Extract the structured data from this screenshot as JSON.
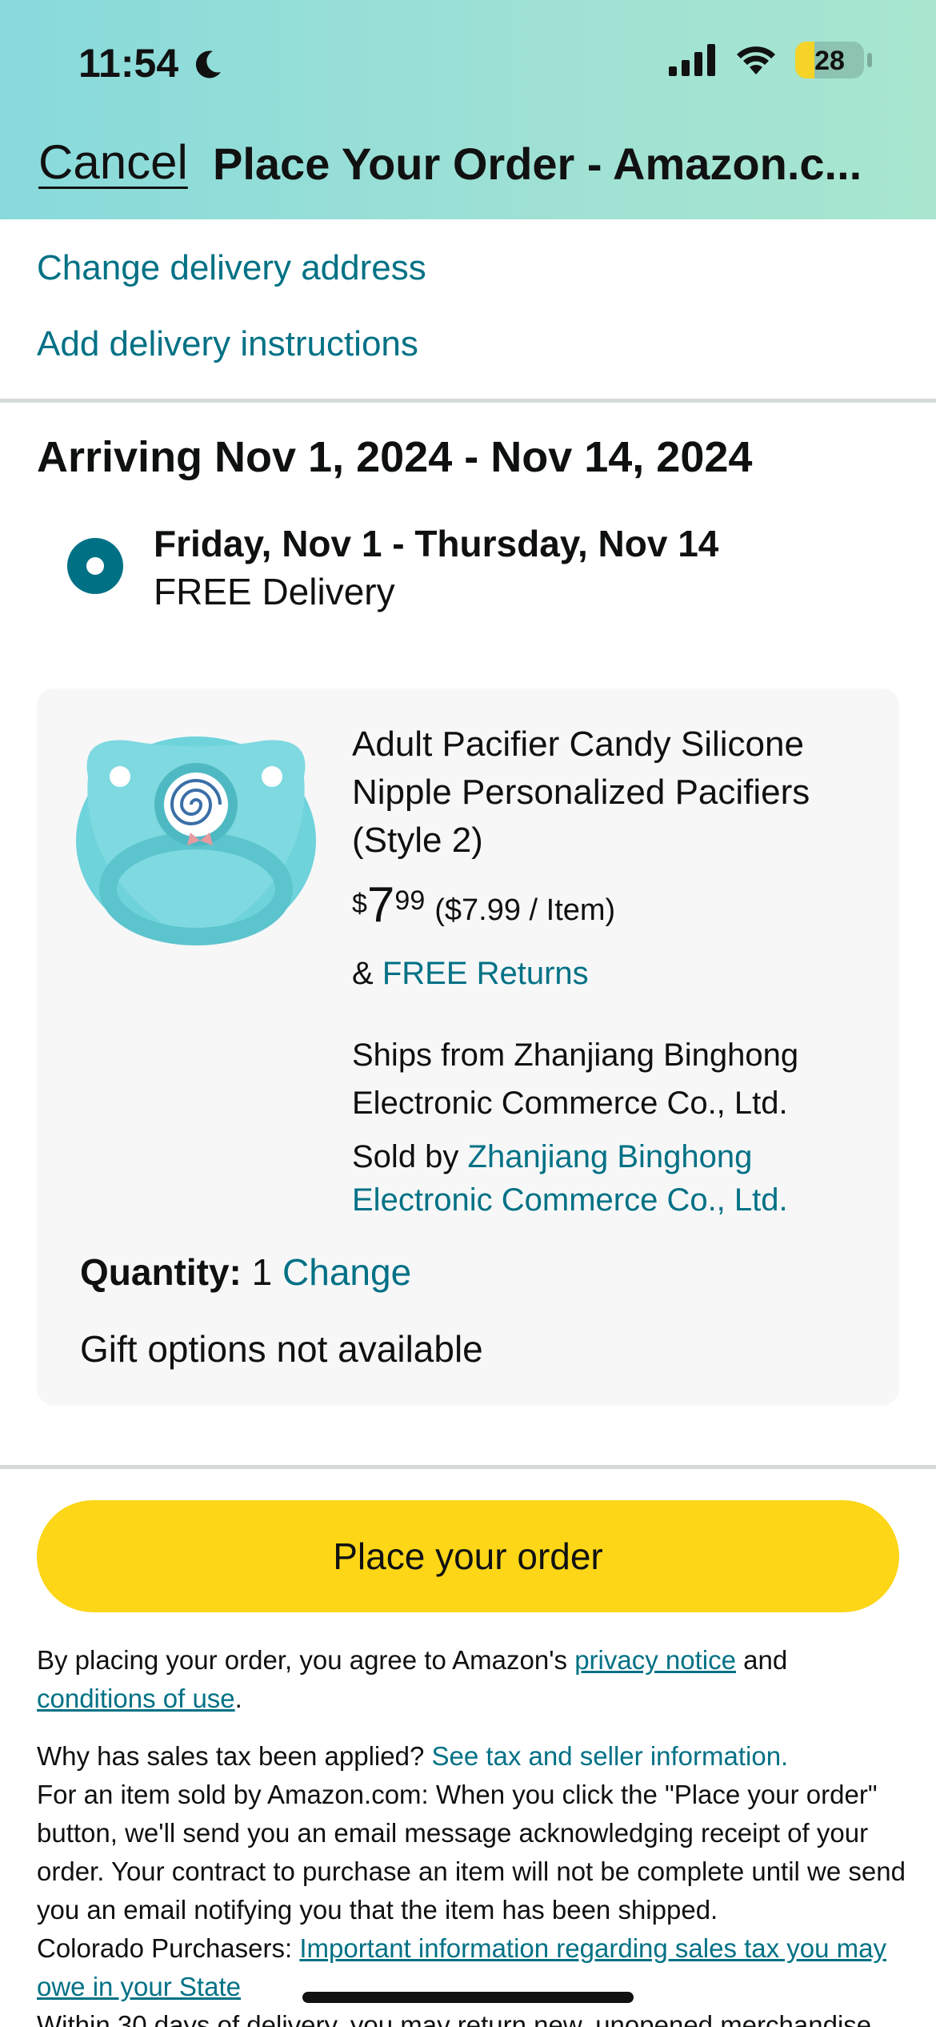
{
  "status_bar": {
    "time": "11:54",
    "battery": "28",
    "battery_level": 0.28,
    "icons": [
      "moon-icon",
      "cellular-signal-icon",
      "wifi-icon",
      "battery-icon"
    ]
  },
  "header": {
    "cancel_label": "Cancel",
    "title": "Place Your Order - Amazon.c..."
  },
  "address_links": {
    "change_address": "Change delivery address",
    "add_instructions": "Add delivery instructions"
  },
  "delivery": {
    "arriving": "Arriving Nov 1, 2024 - Nov 14, 2024",
    "option_dates": "Friday, Nov 1 - Thursday, Nov 14",
    "option_label": "FREE Delivery",
    "selected": true
  },
  "product": {
    "name": "Adult Pacifier Candy Silicone Nipple Personalized Pacifiers (Style 2)",
    "price_currency": "$",
    "price_whole": "7",
    "price_fraction": "99",
    "price_per": "($7.99 / Item)",
    "returns_prefix": "&",
    "returns_label": "FREE Returns",
    "ships_from": "Ships from Zhanjiang Binghong Electronic Commerce Co., Ltd.",
    "sold_by_prefix": "Sold by",
    "sold_by_seller": "Zhanjiang Binghong Electronic Commerce Co., Ltd.",
    "quantity_label": "Quantity:",
    "quantity_value": "1",
    "quantity_change": "Change",
    "gift_options": "Gift options not available"
  },
  "actions": {
    "place_order": "Place your order"
  },
  "legal": {
    "agree_prefix": "By placing your order, you agree to Amazon's",
    "privacy_notice": "privacy notice",
    "agree_and": "and",
    "conditions_of_use": "conditions of use",
    "period": ".",
    "tax_question": "Why has sales tax been applied?",
    "tax_link": "See tax and seller information.",
    "contract_text": "For an item sold by Amazon.com: When you click the \"Place your order\" button, we'll send you an email message acknowledging receipt of your order. Your contract to purchase an item will not be complete until we send you an email notifying you that the item has been shipped.",
    "colorado_prefix": "Colorado Purchasers:",
    "colorado_link": "Important information regarding sales tax you may owe in your State",
    "returns_text": "Within 30 days of delivery, you may return new, unopened merchandise"
  },
  "colors": {
    "accent_link": "#007185",
    "button": "#fcd617"
  }
}
